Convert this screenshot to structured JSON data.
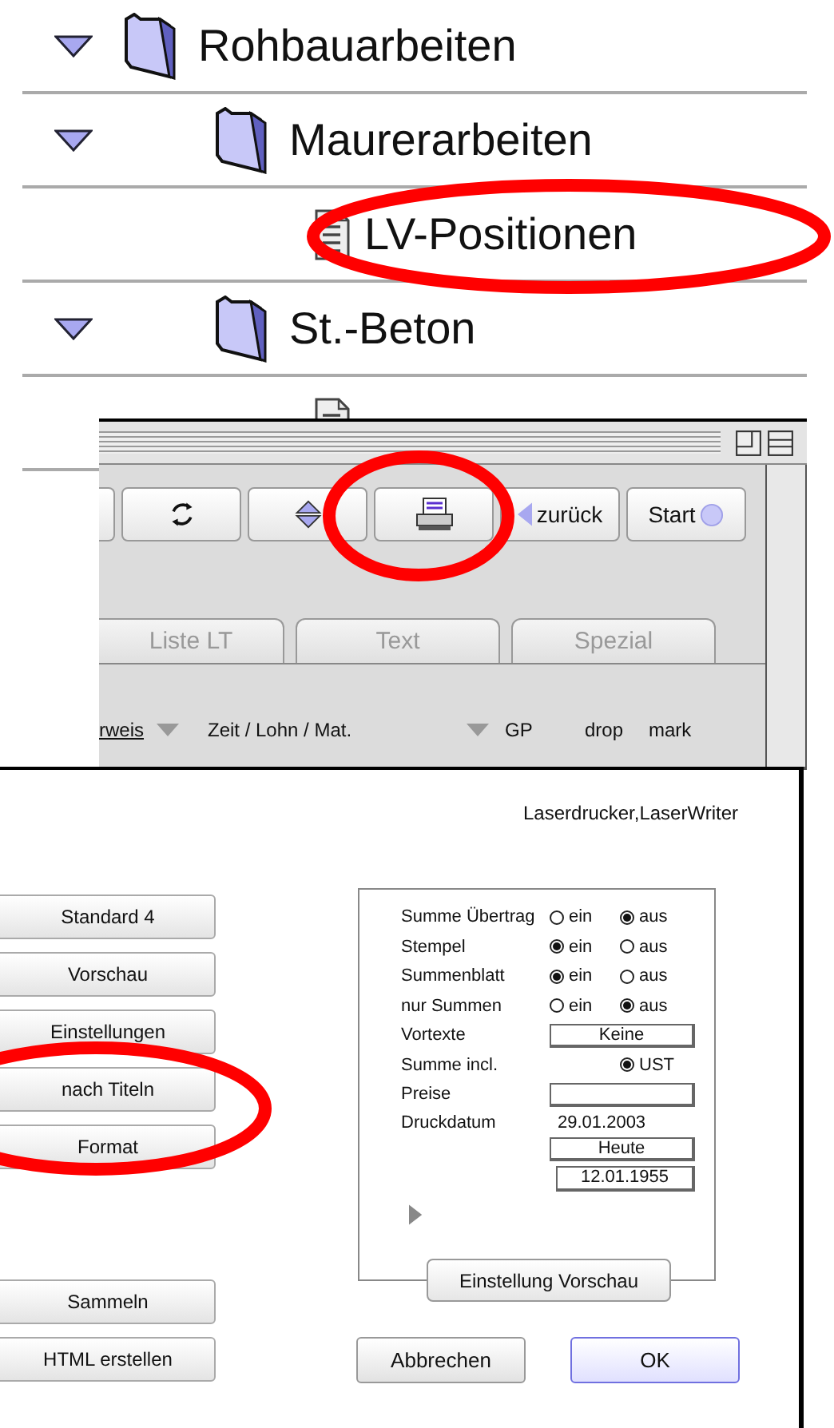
{
  "tree": {
    "rows": [
      {
        "kind": "folder",
        "label": "Rohbauarbeiten",
        "expanded": true,
        "children": [
          {
            "kind": "folder",
            "label": "Maurerarbeiten",
            "expanded": true,
            "children": [
              {
                "kind": "document",
                "label": "LV-Positionen"
              }
            ]
          },
          {
            "kind": "folder",
            "label": "St.-Beton",
            "expanded": true,
            "children": [
              {
                "kind": "document"
              }
            ]
          }
        ]
      }
    ]
  },
  "list_window": {
    "toolbar": [
      {
        "kind": "partial"
      },
      {
        "kind": "refresh"
      },
      {
        "kind": "sort"
      },
      {
        "kind": "print"
      },
      {
        "kind": "back",
        "label": "zurück"
      },
      {
        "kind": "start",
        "label": "Start"
      }
    ],
    "tabs": [
      {
        "label": "Liste LT",
        "selected": false
      },
      {
        "label": "Text",
        "selected": false
      },
      {
        "label": "Spezial",
        "selected": false
      }
    ],
    "columns": [
      {
        "label": "rweis",
        "underlined": true,
        "dropdown": true
      },
      {
        "label": "Zeit / Lohn / Mat.",
        "underlined": false,
        "dropdown": true
      },
      {
        "label": "GP",
        "underlined": false,
        "dropdown": false
      },
      {
        "label": "drop",
        "underlined": false,
        "dropdown": false
      },
      {
        "label": "mark",
        "underlined": false,
        "dropdown": false
      }
    ]
  },
  "print_dialog": {
    "printer": "Laserdrucker,LaserWriter",
    "left_buttons_top": [
      "Standard 4",
      "Vorschau",
      "Einstellungen",
      "nach Titeln",
      "Format"
    ],
    "left_buttons_bottom": [
      "Sammeln",
      "HTML erstellen"
    ],
    "options": [
      {
        "kind": "radio",
        "label": "Summe Übertrag",
        "choices": [
          {
            "label": "ein",
            "selected": false
          },
          {
            "label": "aus",
            "selected": true
          }
        ]
      },
      {
        "kind": "radio",
        "label": "Stempel",
        "choices": [
          {
            "label": "ein",
            "selected": true
          },
          {
            "label": "aus",
            "selected": false
          }
        ]
      },
      {
        "kind": "radio",
        "label": "Summenblatt",
        "choices": [
          {
            "label": "ein",
            "selected": true
          },
          {
            "label": "aus",
            "selected": false
          }
        ]
      },
      {
        "kind": "radio",
        "label": "nur Summen",
        "choices": [
          {
            "label": "ein",
            "selected": false
          },
          {
            "label": "aus",
            "selected": true
          }
        ]
      },
      {
        "kind": "button",
        "label": "Vortexte",
        "button": "Keine"
      },
      {
        "kind": "radio",
        "label": "Summe incl.",
        "choices": [
          {
            "label": "UST",
            "selected": true
          }
        ]
      },
      {
        "kind": "field",
        "label": "Preise"
      },
      {
        "kind": "date",
        "label": "Druckdatum",
        "value": "29.01.2003",
        "button": "Heute",
        "field": "12.01.1955"
      }
    ],
    "more_expanded": false,
    "preview_button": "Einstellung Vorschau",
    "actions": [
      {
        "label": "Abbrechen",
        "default": false
      },
      {
        "label": "OK",
        "default": true
      }
    ]
  }
}
